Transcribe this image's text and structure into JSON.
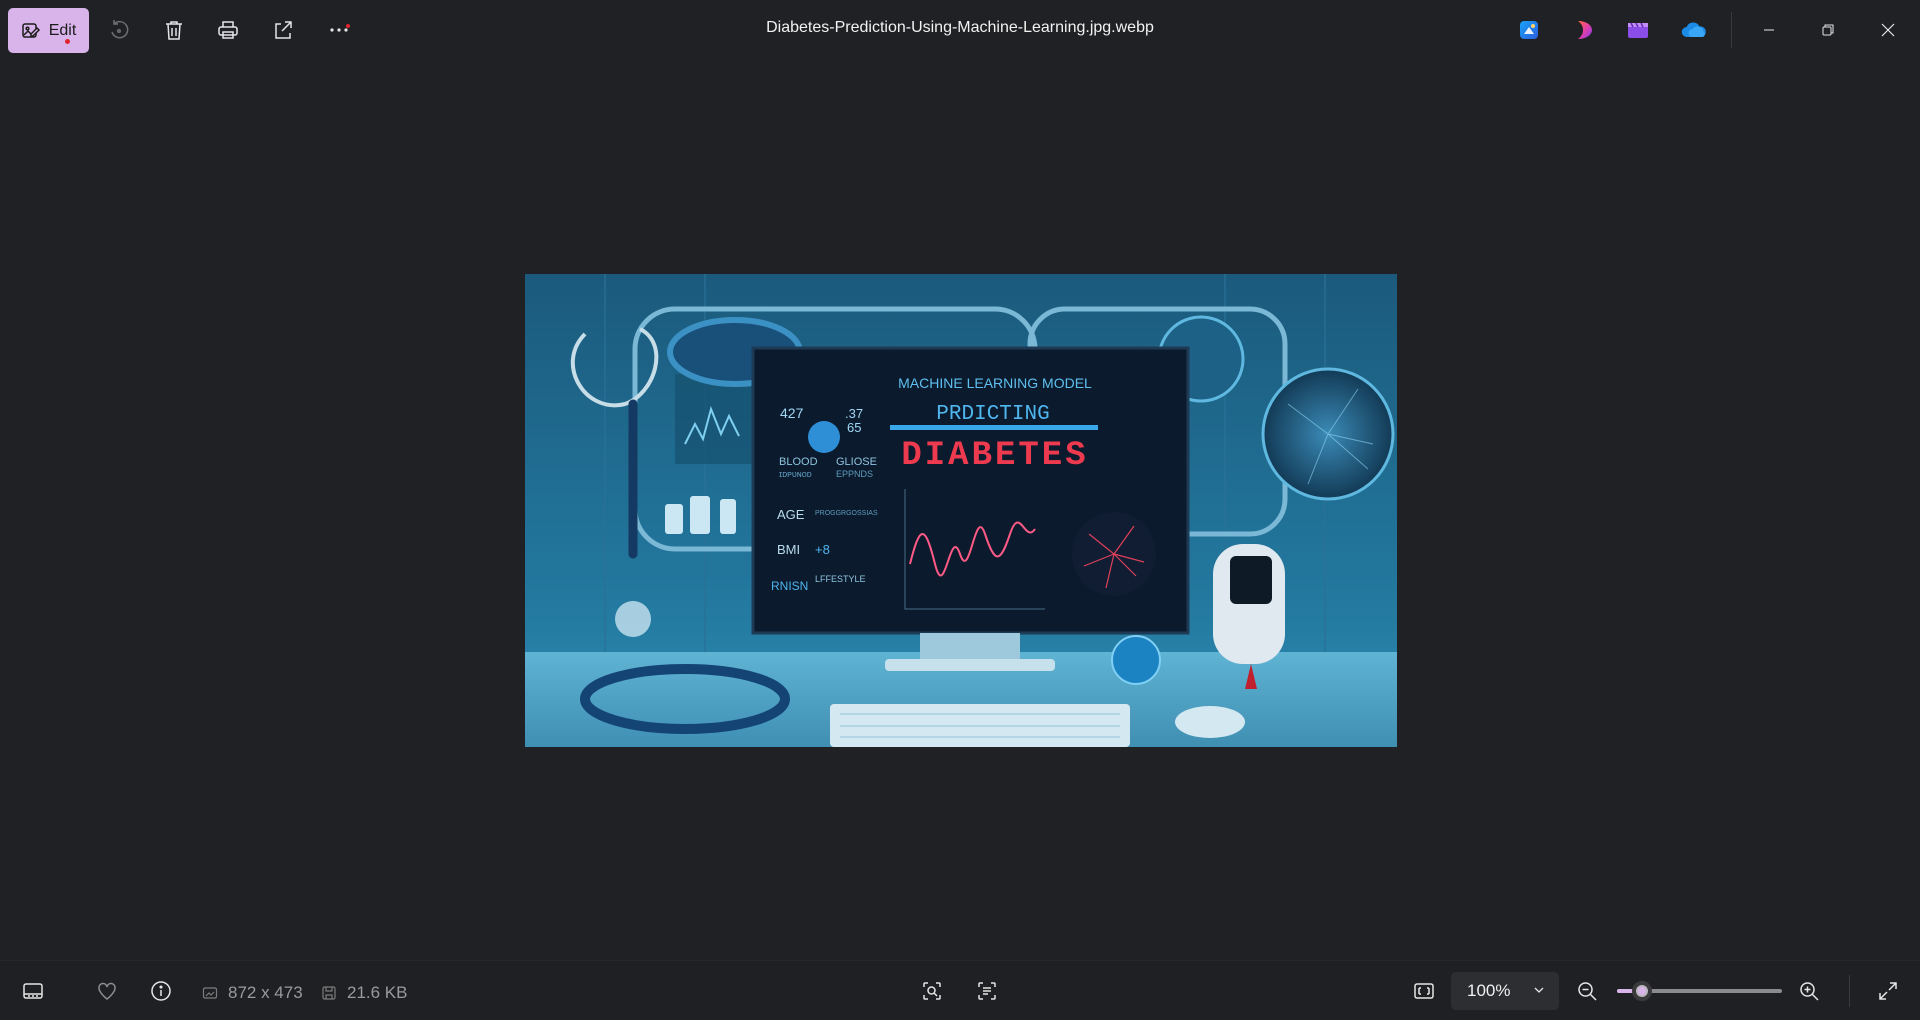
{
  "toolbar": {
    "edit_label": "Edit",
    "more_label": "···"
  },
  "window": {
    "title": "Diabetes-Prediction-Using-Machine-Learning.jpg.webp"
  },
  "app_icons": [
    "designer-icon",
    "clipchamp-icon",
    "video-editor-icon",
    "onedrive-icon"
  ],
  "photo": {
    "texts": {
      "headline": "MACHINE LEARNING MODEL",
      "subhead": "PRDICTING",
      "big": "DIABETES",
      "n1": "427",
      "n2": ".37",
      "n3": "65",
      "blood": "BLOOD",
      "blood_sub": "ɪᴅᴘᴜɴᴏᴅ",
      "gluose": "GLIOSE",
      "gluose_sub": "EPPNDS",
      "age": "AGE",
      "age_sub": "PROGGRGOSSIAS",
      "bmi": "BMI",
      "bmi_val": "+8",
      "rnisn": "RNISN",
      "lifestyle": "LFFESTYLE"
    }
  },
  "bottom": {
    "dimensions": "872 x 473",
    "filesize": "21.6 KB",
    "zoom_value": "100%",
    "zoom_fraction": 0.15
  },
  "colors": {
    "accent": "#d9b4ea",
    "background": "#202124",
    "bottombar": "#1f2023"
  }
}
